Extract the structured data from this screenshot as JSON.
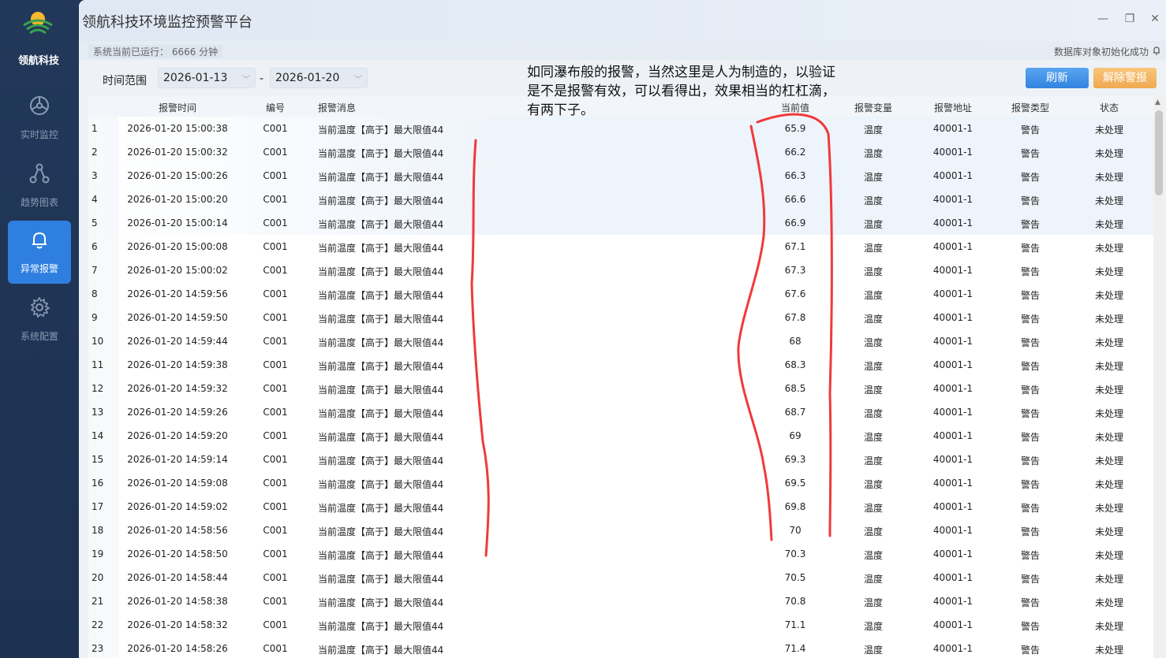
{
  "sidebar": {
    "brand": "领航科技",
    "items": [
      {
        "label": "实时监控",
        "icon": "monitor-icon",
        "active": false
      },
      {
        "label": "趋势图表",
        "icon": "trend-icon",
        "active": false
      },
      {
        "label": "异常报警",
        "icon": "bell-icon",
        "active": true
      },
      {
        "label": "系统配置",
        "icon": "gear-icon",
        "active": false
      }
    ]
  },
  "window": {
    "title": "领航科技环境监控预警平台",
    "minimize": "—",
    "maximize": "❐",
    "close": "✕"
  },
  "status": {
    "runtime_label": "系统当前已运行：  6666 分钟",
    "db_message": "数据库对象初始化成功"
  },
  "filter": {
    "range_label": "时间范围",
    "start_date": "2026-01-13",
    "end_date": "2026-01-20",
    "separator": "-",
    "refresh_label": "刷新",
    "clear_label": "解除警报"
  },
  "table": {
    "headers": {
      "time": "报警时间",
      "code": "编号",
      "message": "报警消息",
      "value": "当前值",
      "variable": "报警变量",
      "address": "报警地址",
      "type": "报警类型",
      "state": "状态"
    },
    "rows": [
      {
        "idx": "1",
        "time": "2026-01-20 15:00:38",
        "code": "C001",
        "msg": "当前温度【高于】最大限值44",
        "val": "65.9",
        "var": "温度",
        "addr": "40001-1",
        "type": "警告",
        "state": "未处理"
      },
      {
        "idx": "2",
        "time": "2026-01-20 15:00:32",
        "code": "C001",
        "msg": "当前温度【高于】最大限值44",
        "val": "66.2",
        "var": "温度",
        "addr": "40001-1",
        "type": "警告",
        "state": "未处理"
      },
      {
        "idx": "3",
        "time": "2026-01-20 15:00:26",
        "code": "C001",
        "msg": "当前温度【高于】最大限值44",
        "val": "66.3",
        "var": "温度",
        "addr": "40001-1",
        "type": "警告",
        "state": "未处理"
      },
      {
        "idx": "4",
        "time": "2026-01-20 15:00:20",
        "code": "C001",
        "msg": "当前温度【高于】最大限值44",
        "val": "66.6",
        "var": "温度",
        "addr": "40001-1",
        "type": "警告",
        "state": "未处理"
      },
      {
        "idx": "5",
        "time": "2026-01-20 15:00:14",
        "code": "C001",
        "msg": "当前温度【高于】最大限值44",
        "val": "66.9",
        "var": "温度",
        "addr": "40001-1",
        "type": "警告",
        "state": "未处理"
      },
      {
        "idx": "6",
        "time": "2026-01-20 15:00:08",
        "code": "C001",
        "msg": "当前温度【高于】最大限值44",
        "val": "67.1",
        "var": "温度",
        "addr": "40001-1",
        "type": "警告",
        "state": "未处理"
      },
      {
        "idx": "7",
        "time": "2026-01-20 15:00:02",
        "code": "C001",
        "msg": "当前温度【高于】最大限值44",
        "val": "67.3",
        "var": "温度",
        "addr": "40001-1",
        "type": "警告",
        "state": "未处理"
      },
      {
        "idx": "8",
        "time": "2026-01-20 14:59:56",
        "code": "C001",
        "msg": "当前温度【高于】最大限值44",
        "val": "67.6",
        "var": "温度",
        "addr": "40001-1",
        "type": "警告",
        "state": "未处理"
      },
      {
        "idx": "9",
        "time": "2026-01-20 14:59:50",
        "code": "C001",
        "msg": "当前温度【高于】最大限值44",
        "val": "67.8",
        "var": "温度",
        "addr": "40001-1",
        "type": "警告",
        "state": "未处理"
      },
      {
        "idx": "10",
        "time": "2026-01-20 14:59:44",
        "code": "C001",
        "msg": "当前温度【高于】最大限值44",
        "val": "68",
        "var": "温度",
        "addr": "40001-1",
        "type": "警告",
        "state": "未处理"
      },
      {
        "idx": "11",
        "time": "2026-01-20 14:59:38",
        "code": "C001",
        "msg": "当前温度【高于】最大限值44",
        "val": "68.3",
        "var": "温度",
        "addr": "40001-1",
        "type": "警告",
        "state": "未处理"
      },
      {
        "idx": "12",
        "time": "2026-01-20 14:59:32",
        "code": "C001",
        "msg": "当前温度【高于】最大限值44",
        "val": "68.5",
        "var": "温度",
        "addr": "40001-1",
        "type": "警告",
        "state": "未处理"
      },
      {
        "idx": "13",
        "time": "2026-01-20 14:59:26",
        "code": "C001",
        "msg": "当前温度【高于】最大限值44",
        "val": "68.7",
        "var": "温度",
        "addr": "40001-1",
        "type": "警告",
        "state": "未处理"
      },
      {
        "idx": "14",
        "time": "2026-01-20 14:59:20",
        "code": "C001",
        "msg": "当前温度【高于】最大限值44",
        "val": "69",
        "var": "温度",
        "addr": "40001-1",
        "type": "警告",
        "state": "未处理"
      },
      {
        "idx": "15",
        "time": "2026-01-20 14:59:14",
        "code": "C001",
        "msg": "当前温度【高于】最大限值44",
        "val": "69.3",
        "var": "温度",
        "addr": "40001-1",
        "type": "警告",
        "state": "未处理"
      },
      {
        "idx": "16",
        "time": "2026-01-20 14:59:08",
        "code": "C001",
        "msg": "当前温度【高于】最大限值44",
        "val": "69.5",
        "var": "温度",
        "addr": "40001-1",
        "type": "警告",
        "state": "未处理"
      },
      {
        "idx": "17",
        "time": "2026-01-20 14:59:02",
        "code": "C001",
        "msg": "当前温度【高于】最大限值44",
        "val": "69.8",
        "var": "温度",
        "addr": "40001-1",
        "type": "警告",
        "state": "未处理"
      },
      {
        "idx": "18",
        "time": "2026-01-20 14:58:56",
        "code": "C001",
        "msg": "当前温度【高于】最大限值44",
        "val": "70",
        "var": "温度",
        "addr": "40001-1",
        "type": "警告",
        "state": "未处理"
      },
      {
        "idx": "19",
        "time": "2026-01-20 14:58:50",
        "code": "C001",
        "msg": "当前温度【高于】最大限值44",
        "val": "70.3",
        "var": "温度",
        "addr": "40001-1",
        "type": "警告",
        "state": "未处理"
      },
      {
        "idx": "20",
        "time": "2026-01-20 14:58:44",
        "code": "C001",
        "msg": "当前温度【高于】最大限值44",
        "val": "70.5",
        "var": "温度",
        "addr": "40001-1",
        "type": "警告",
        "state": "未处理"
      },
      {
        "idx": "21",
        "time": "2026-01-20 14:58:38",
        "code": "C001",
        "msg": "当前温度【高于】最大限值44",
        "val": "70.8",
        "var": "温度",
        "addr": "40001-1",
        "type": "警告",
        "state": "未处理"
      },
      {
        "idx": "22",
        "time": "2026-01-20 14:58:32",
        "code": "C001",
        "msg": "当前温度【高于】最大限值44",
        "val": "71.1",
        "var": "温度",
        "addr": "40001-1",
        "type": "警告",
        "state": "未处理"
      },
      {
        "idx": "23",
        "time": "2026-01-20 14:58:26",
        "code": "C001",
        "msg": "当前温度【高于】最大限值44",
        "val": "71.4",
        "var": "温度",
        "addr": "40001-1",
        "type": "警告",
        "state": "未处理"
      }
    ]
  },
  "annotation": {
    "text": "如同瀑布般的报警，当然这里是人为制造的，以验证是不是报警有效，可以看得出，效果相当的杠杠滴，有两下子。",
    "ink_color": "#f03a3a"
  },
  "colors": {
    "sidebar_bg": "#22385a",
    "active_nav": "#2f7fe0",
    "refresh_btn": "#3f8fe8",
    "clear_btn": "#f2b060"
  }
}
